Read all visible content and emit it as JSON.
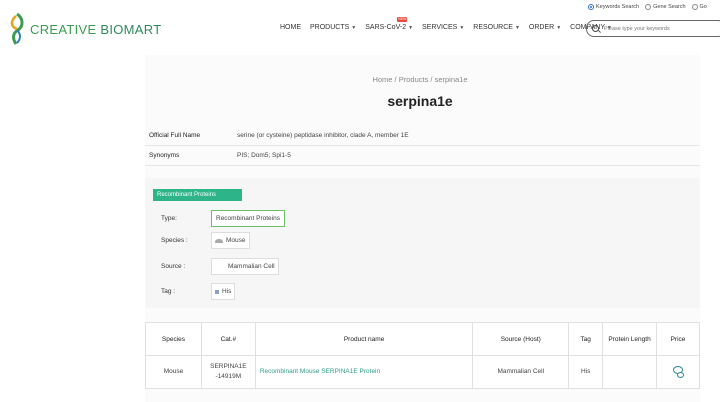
{
  "search_type": {
    "options": [
      "Keywords Search",
      "Gene Search",
      "Go"
    ],
    "selected": "Keywords Search"
  },
  "logo": {
    "word1": "CREATIVE",
    "word2": "BIOMART"
  },
  "nav": {
    "items": [
      {
        "label": "HOME",
        "dropdown": false
      },
      {
        "label": "PRODUCTS",
        "dropdown": true
      },
      {
        "label": "SARS-CoV-2",
        "dropdown": true,
        "badge": "NEW"
      },
      {
        "label": "SERVICES",
        "dropdown": true
      },
      {
        "label": "RESOURCE",
        "dropdown": true
      },
      {
        "label": "ORDER",
        "dropdown": true
      },
      {
        "label": "COMPANY",
        "dropdown": true
      }
    ]
  },
  "search": {
    "placeholder": "Please type your keywords"
  },
  "breadcrumb": "Home / Products / serpina1e",
  "page_title": "serpina1e",
  "info": {
    "full_name_label": "Official Full Name",
    "full_name_value": "serine (or cysteine) peptidase inhibitor, clade A, member 1E",
    "synonyms_label": "Synonyms",
    "synonyms_value": "PIS; Dom5; Spi1-5"
  },
  "filters": {
    "header": "Recombinant Proteins",
    "type_label": "Type:",
    "type_value": "Recombinant Proteins",
    "species_label": "Species :",
    "species_value": "Mouse",
    "source_label": "Source :",
    "source_value": "Mammalian Cell",
    "tag_label": "Tag :",
    "tag_value": "His"
  },
  "table": {
    "headers": [
      "Species",
      "Cat.#",
      "Product name",
      "Source (Host)",
      "Tag",
      "Protein Length",
      "Price"
    ],
    "rows": [
      {
        "species": "Mouse",
        "cat": "SERPINA1E-14919M",
        "product": "Recombinant Mouse SERPINA1E Protein",
        "source": "Mammalian Cell",
        "tag": "His",
        "length": ""
      }
    ]
  },
  "colors": {
    "brand_green": "#2db488",
    "link": "#2e9d8a"
  }
}
